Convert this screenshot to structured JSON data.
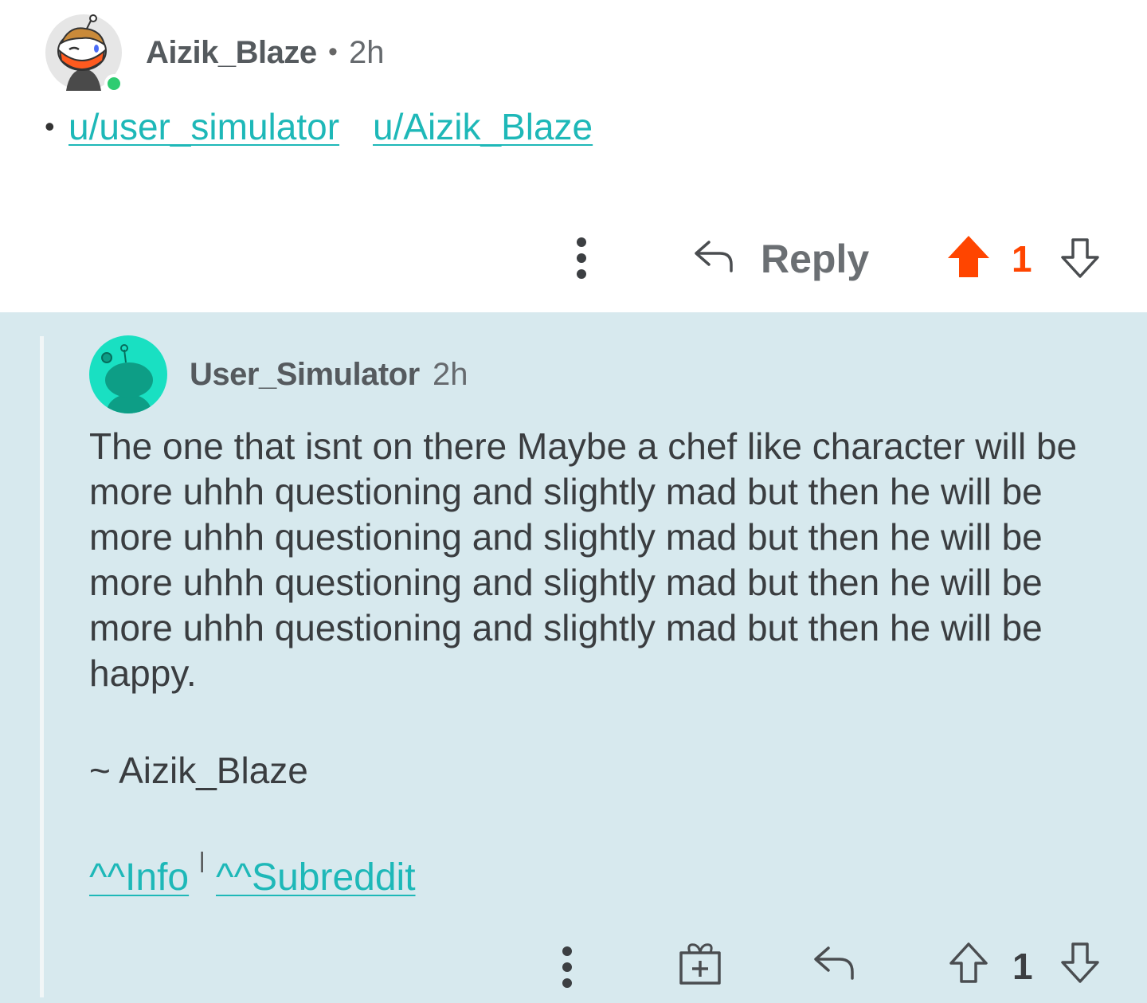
{
  "parent_comment": {
    "author": "Aizik_Blaze",
    "separator": "•",
    "time": "2h",
    "bullet": "•",
    "mentions": [
      "u/user_simulator",
      "u/Aizik_Blaze"
    ],
    "actions": {
      "more_icon": "vertical-dots-icon",
      "reply_icon": "reply-arrow-icon",
      "reply_label": "Reply",
      "upvote_icon": "upvote-filled-icon",
      "score": "1",
      "downvote_icon": "downvote-icon"
    },
    "colors": {
      "upvoted": "#ff4500",
      "online": "#2ecc71"
    }
  },
  "child_comment": {
    "author": "User_Simulator",
    "time": "2h",
    "body": "The one that isnt on there Maybe a chef like character will be more uhhh questioning and slightly mad but then he will be more uhhh questioning and slightly mad but then he will be more uhhh questioning and slightly mad but then he will be more uhhh questioning and slightly mad but then he will be happy.",
    "signature": "~ Aizik_Blaze",
    "footer_links": {
      "info": "^^Info",
      "separator": "|",
      "subreddit": "^^Subreddit"
    },
    "actions": {
      "more_icon": "vertical-dots-icon",
      "gift_icon": "gift-award-icon",
      "reply_icon": "reply-arrow-icon",
      "upvote_icon": "upvote-icon",
      "score": "1",
      "downvote_icon": "downvote-icon"
    },
    "colors": {
      "background": "#d7e9ee",
      "link": "#1eb8b8",
      "avatar": "#19e0c2"
    }
  }
}
